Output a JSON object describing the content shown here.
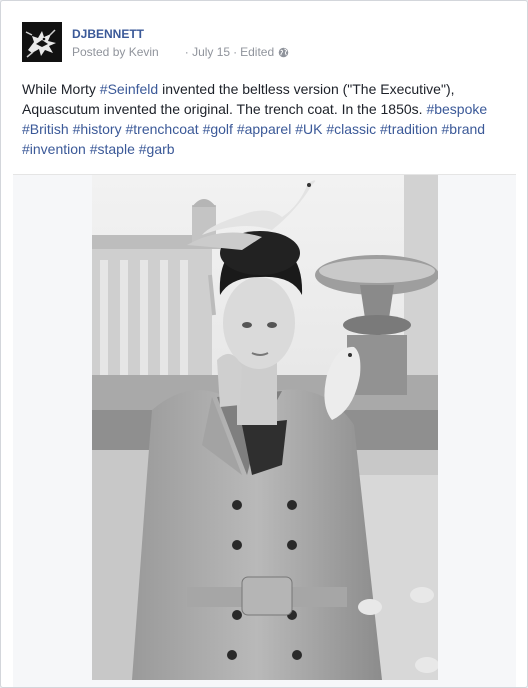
{
  "post": {
    "page_name": "DJBENNETT",
    "posted_by": "Posted by Kevin",
    "date": "July 15",
    "edited": "Edited",
    "dot": "·",
    "privacy_icon": "globe-icon",
    "text_segments": [
      {
        "text": "While Morty ",
        "tag": false
      },
      {
        "text": "#Seinfeld",
        "tag": true
      },
      {
        "text": " invented the beltless version (\"The Executive\"), Aquascutum invented the original. The trench coat. In the 1850s. ",
        "tag": false
      },
      {
        "text": "#bespoke",
        "tag": true
      },
      {
        "text": " ",
        "tag": false
      },
      {
        "text": "#British",
        "tag": true
      },
      {
        "text": " ",
        "tag": false
      },
      {
        "text": "#history",
        "tag": true
      },
      {
        "text": " ",
        "tag": false
      },
      {
        "text": "#trenchcoat",
        "tag": true
      },
      {
        "text": " ",
        "tag": false
      },
      {
        "text": "#golf",
        "tag": true
      },
      {
        "text": " ",
        "tag": false
      },
      {
        "text": "#apparel",
        "tag": true
      },
      {
        "text": " ",
        "tag": false
      },
      {
        "text": "#UK",
        "tag": true
      },
      {
        "text": " ",
        "tag": false
      },
      {
        "text": "#classic",
        "tag": true
      },
      {
        "text": " ",
        "tag": false
      },
      {
        "text": "#tradition",
        "tag": true
      },
      {
        "text": " ",
        "tag": false
      },
      {
        "text": "#brand",
        "tag": true
      },
      {
        "text": " ",
        "tag": false
      },
      {
        "text": "#invention",
        "tag": true
      },
      {
        "text": " ",
        "tag": false
      },
      {
        "text": "#staple",
        "tag": true
      },
      {
        "text": " ",
        "tag": false
      },
      {
        "text": "#garb",
        "tag": true
      }
    ]
  },
  "colors": {
    "link": "#3b5998",
    "meta": "#90949c",
    "text": "#1d2129"
  }
}
